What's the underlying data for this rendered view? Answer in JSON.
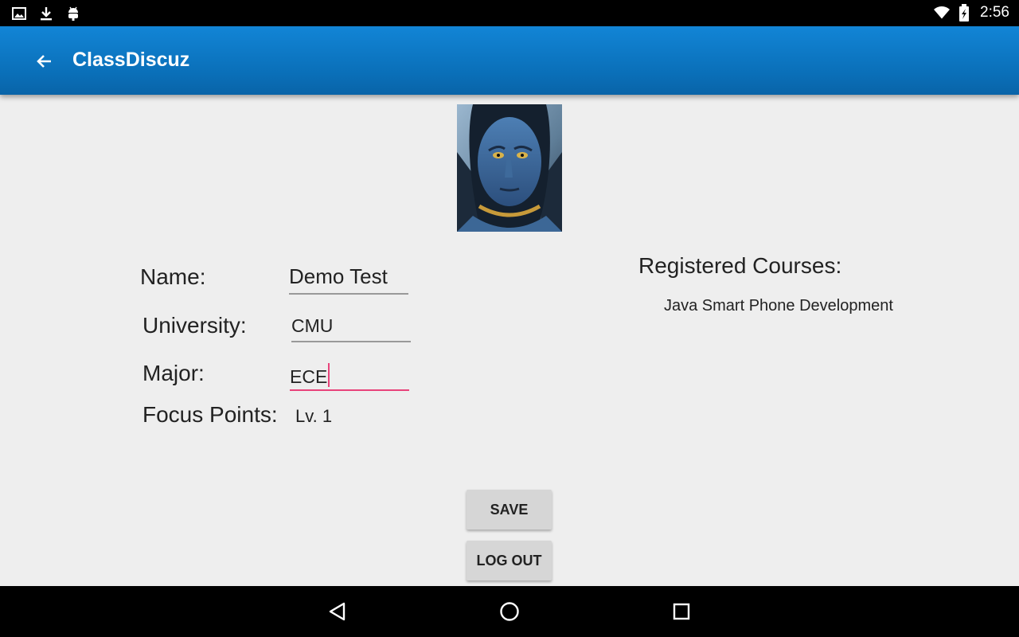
{
  "status_bar": {
    "left_icons": [
      "image-icon",
      "download-icon",
      "android-icon"
    ],
    "right_icons": [
      "wifi-icon",
      "battery-icon"
    ],
    "time": "2:56"
  },
  "app_bar": {
    "title": "ClassDiscuz",
    "back_icon": "arrow-back-icon"
  },
  "profile": {
    "name_label": "Name:",
    "name_value": "Demo Test",
    "university_label": "University:",
    "university_value": "CMU",
    "major_label": "Major:",
    "major_value": "ECE",
    "focus_label": "Focus Points:",
    "focus_value": "Lv. 1"
  },
  "courses": {
    "title": "Registered Courses:",
    "items": [
      "Java Smart Phone Development"
    ]
  },
  "buttons": {
    "save": "SAVE",
    "logout": "LOG OUT"
  },
  "nav_bar": {
    "icons": [
      "back-icon",
      "home-icon",
      "recents-icon"
    ]
  },
  "colors": {
    "app_bar": "#0a72bd",
    "focus_underline": "#e8437a",
    "background": "#eeeeee"
  }
}
